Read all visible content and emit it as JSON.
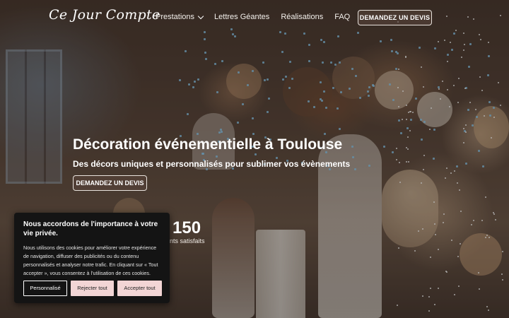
{
  "header": {
    "logo_text": "Ce Jour Compte",
    "nav": [
      {
        "label": "Prestations"
      },
      {
        "label": "Lettres Géantes"
      },
      {
        "label": "Réalisations"
      },
      {
        "label": "FAQ"
      }
    ],
    "cta_label": "DEMANDEZ UN DEVIS"
  },
  "hero": {
    "title": "Décoration événementielle à Toulouse",
    "subtitle": "Des décors uniques et personnalisés pour sublimer vos évènements",
    "cta_label": "DEMANDEZ UN DEVIS",
    "stat_number": "150",
    "stat_label": "nts satisfaits"
  },
  "cookie_banner": {
    "title": "Nous accordons de l'importance à votre vie privée.",
    "body": "Nous utilisons des cookies pour améliorer votre expérience de navigation, diffuser des publicités ou du contenu personnalisés et analyser notre trafic. En cliquant sur « Tout accepter », vous consentez à l'utilisation de ces cookies.",
    "buttons": {
      "customize": "Personnalisé",
      "reject": "Rejecter tout",
      "accept": "Accepter tout"
    }
  },
  "icons": {
    "nav_dropdown": "chevron-down-icon"
  },
  "colors": {
    "cookie_bg": "#141414",
    "cookie_button_fill": "#f2d5d5",
    "confetti": "#8cc8eb"
  }
}
